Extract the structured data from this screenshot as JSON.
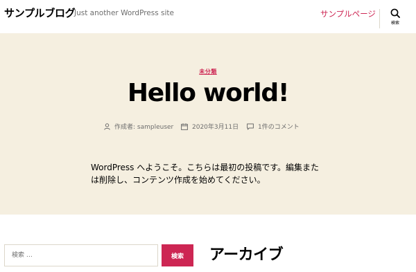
{
  "header": {
    "site_title": "サンプルブログ",
    "tagline": "Just another WordPress site",
    "nav_link": "サンプルページ",
    "search_label": "検索"
  },
  "post": {
    "category": "未分類",
    "title": "Hello world!",
    "meta": {
      "author": "作成者: sampleuser",
      "date": "2020年3月11日",
      "comments": "1件のコメント"
    },
    "content": "WordPress へようこそ。こちらは最初の投稿です。編集または削除し、コンテンツ作成を始めてください。"
  },
  "widgets": {
    "search_placeholder": "検索 …",
    "search_button": "検索",
    "archive_title": "アーカイブ"
  },
  "colors": {
    "accent": "#cd2653",
    "header_band": "#f5efe0",
    "meta_text": "#6d6d6d"
  },
  "icons": {
    "search": "search-icon",
    "author": "user-icon",
    "date": "calendar-icon",
    "comments": "comment-icon"
  }
}
